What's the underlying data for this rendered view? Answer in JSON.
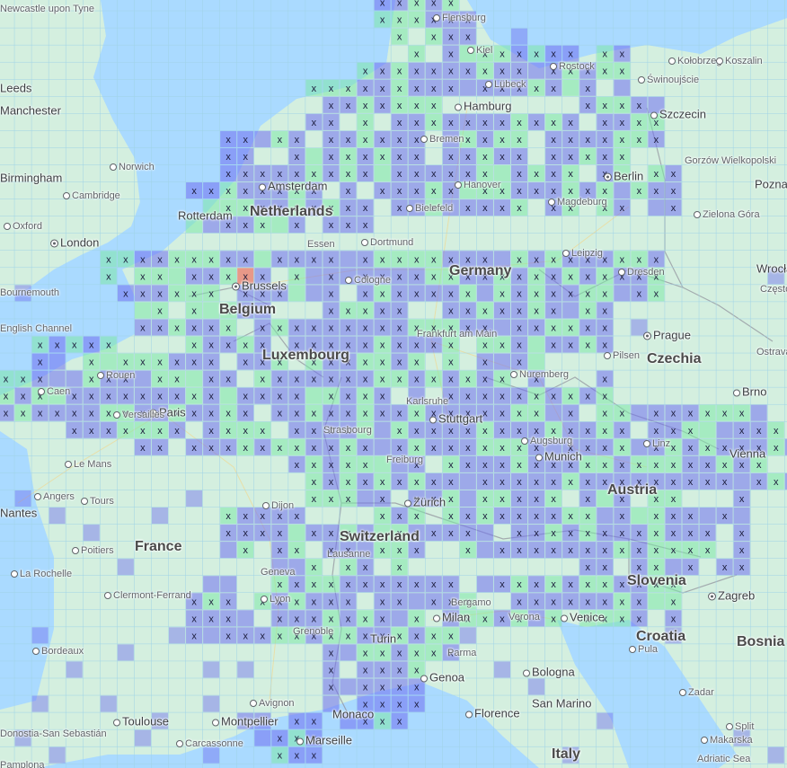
{
  "map": {
    "colors": {
      "sea": "#aadaff",
      "land": "#d4efdf",
      "cell_low": "#6f6ff0",
      "cell_mid": "#7de8a8",
      "cell_high": "#ef7b6b",
      "grid_line": "#9fd3e6",
      "mark": "#1a1a3a"
    },
    "cell_marker": "x",
    "labels": [
      {
        "id": "newcastle",
        "text": "Newcastle upon Tyne",
        "kind": "small"
      },
      {
        "id": "leeds",
        "text": "Leeds",
        "kind": "big"
      },
      {
        "id": "manchester",
        "text": "Manchester",
        "kind": "big"
      },
      {
        "id": "birmingham",
        "text": "Birmingham",
        "kind": "big"
      },
      {
        "id": "norwich",
        "text": "Norwich",
        "kind": "small",
        "dot": true
      },
      {
        "id": "cambridge",
        "text": "Cambridge",
        "kind": "small",
        "dot": true
      },
      {
        "id": "oxford",
        "text": "Oxford",
        "kind": "small",
        "dot": true
      },
      {
        "id": "london",
        "text": "London",
        "kind": "big",
        "dot": true,
        "capital": true
      },
      {
        "id": "bournemouth",
        "text": "Bournemouth",
        "kind": "small"
      },
      {
        "id": "flensburg",
        "text": "Flensburg",
        "kind": "small",
        "dot": true
      },
      {
        "id": "kiel",
        "text": "Kiel",
        "kind": "small",
        "dot": true
      },
      {
        "id": "rostock",
        "text": "Rostock",
        "kind": "small",
        "dot": true
      },
      {
        "id": "lubeck",
        "text": "Lübeck",
        "kind": "small",
        "dot": true
      },
      {
        "id": "kolobrzeg",
        "text": "Kołobrzeg",
        "kind": "small",
        "dot": true
      },
      {
        "id": "koszalin",
        "text": "Koszalin",
        "kind": "small",
        "dot": true
      },
      {
        "id": "swinoujscie",
        "text": "Świnoujście",
        "kind": "small",
        "dot": true
      },
      {
        "id": "hamburg",
        "text": "Hamburg",
        "kind": "big",
        "dot": true
      },
      {
        "id": "szczecin",
        "text": "Szczecin",
        "kind": "big",
        "dot": true
      },
      {
        "id": "bremen",
        "text": "Bremen",
        "kind": "small",
        "dot": true
      },
      {
        "id": "gorzow",
        "text": "Gorzów Wielkopolski",
        "kind": "small"
      },
      {
        "id": "poznan",
        "text": "Poznań",
        "kind": "big"
      },
      {
        "id": "berlin",
        "text": "Berlin",
        "kind": "big",
        "dot": true,
        "capital": true
      },
      {
        "id": "amsterdam",
        "text": "Amsterdam",
        "kind": "big",
        "dot": true
      },
      {
        "id": "hanover",
        "text": "Hanover",
        "kind": "small",
        "dot": true
      },
      {
        "id": "magdeburg",
        "text": "Magdeburg",
        "kind": "small",
        "dot": true
      },
      {
        "id": "netherlands",
        "text": "Netherlands",
        "kind": "country"
      },
      {
        "id": "rotterdam",
        "text": "Rotterdam",
        "kind": "big"
      },
      {
        "id": "bielefeld",
        "text": "Bielefeld",
        "kind": "small",
        "dot": true
      },
      {
        "id": "zielona",
        "text": "Zielona Góra",
        "kind": "small",
        "dot": true
      },
      {
        "id": "essen",
        "text": "Essen",
        "kind": "small"
      },
      {
        "id": "dortmund",
        "text": "Dortmund",
        "kind": "small",
        "dot": true
      },
      {
        "id": "leipzig",
        "text": "Leipzig",
        "kind": "small",
        "dot": true
      },
      {
        "id": "germany",
        "text": "Germany",
        "kind": "country"
      },
      {
        "id": "dresden",
        "text": "Dresden",
        "kind": "small",
        "dot": true
      },
      {
        "id": "wroclaw",
        "text": "Wrocław",
        "kind": "big"
      },
      {
        "id": "czestochowa",
        "text": "Częstochowa",
        "kind": "small"
      },
      {
        "id": "brussels",
        "text": "Brussels",
        "kind": "big",
        "dot": true,
        "capital": true
      },
      {
        "id": "cologne",
        "text": "Cologne",
        "kind": "small",
        "dot": true
      },
      {
        "id": "belgium",
        "text": "Belgium",
        "kind": "country"
      },
      {
        "id": "frankfurt",
        "text": "Frankfurt am Main",
        "kind": "small"
      },
      {
        "id": "prague",
        "text": "Prague",
        "kind": "big",
        "dot": true,
        "capital": true
      },
      {
        "id": "luxembourg",
        "text": "Luxembourg",
        "kind": "country"
      },
      {
        "id": "pilsen",
        "text": "Pilsen",
        "kind": "small",
        "dot": true
      },
      {
        "id": "czechia",
        "text": "Czechia",
        "kind": "country"
      },
      {
        "id": "ostrava",
        "text": "Ostrava",
        "kind": "small"
      },
      {
        "id": "rouen",
        "text": "Rouen",
        "kind": "small",
        "dot": true
      },
      {
        "id": "nuremberg",
        "text": "Nuremberg",
        "kind": "small",
        "dot": true
      },
      {
        "id": "caen",
        "text": "Caen",
        "kind": "small",
        "dot": true
      },
      {
        "id": "brno",
        "text": "Brno",
        "kind": "big",
        "dot": true
      },
      {
        "id": "paris",
        "text": "Paris",
        "kind": "big",
        "dot": true,
        "capital": true
      },
      {
        "id": "versailles",
        "text": "Versailles",
        "kind": "small",
        "dot": true
      },
      {
        "id": "karlsruhe",
        "text": "Karlsruhe",
        "kind": "small"
      },
      {
        "id": "stuttgart",
        "text": "Stuttgart",
        "kind": "big",
        "dot": true
      },
      {
        "id": "lemans",
        "text": "Le Mans",
        "kind": "small",
        "dot": true
      },
      {
        "id": "strasbourg",
        "text": "Strasbourg",
        "kind": "small"
      },
      {
        "id": "augsburg",
        "text": "Augsburg",
        "kind": "small",
        "dot": true
      },
      {
        "id": "linz",
        "text": "Linz",
        "kind": "small",
        "dot": true
      },
      {
        "id": "vienna",
        "text": "Vienna",
        "kind": "big"
      },
      {
        "id": "freiburg",
        "text": "Freiburg",
        "kind": "small"
      },
      {
        "id": "munich",
        "text": "Munich",
        "kind": "big",
        "dot": true
      },
      {
        "id": "angers",
        "text": "Angers",
        "kind": "small",
        "dot": true
      },
      {
        "id": "tours",
        "text": "Tours",
        "kind": "small",
        "dot": true
      },
      {
        "id": "nantes",
        "text": "Nantes",
        "kind": "big"
      },
      {
        "id": "zurich",
        "text": "Zürich",
        "kind": "big",
        "dot": true
      },
      {
        "id": "austria",
        "text": "Austria",
        "kind": "country"
      },
      {
        "id": "dijon",
        "text": "Dijon",
        "kind": "small",
        "dot": true
      },
      {
        "id": "france",
        "text": "France",
        "kind": "country"
      },
      {
        "id": "switzerland",
        "text": "Switzerland",
        "kind": "country"
      },
      {
        "id": "poitiers",
        "text": "Poitiers",
        "kind": "small",
        "dot": true
      },
      {
        "id": "lausanne",
        "text": "Lausanne",
        "kind": "small"
      },
      {
        "id": "geneva",
        "text": "Geneva",
        "kind": "small"
      },
      {
        "id": "larochelle",
        "text": "La Rochelle",
        "kind": "small",
        "dot": true
      },
      {
        "id": "slovenia",
        "text": "Slovenia",
        "kind": "country"
      },
      {
        "id": "clermont",
        "text": "Clermont-Ferrand",
        "kind": "small",
        "dot": true
      },
      {
        "id": "lyon",
        "text": "Lyon",
        "kind": "small",
        "dot": true
      },
      {
        "id": "zagreb",
        "text": "Zagreb",
        "kind": "big",
        "dot": true,
        "capital": true
      },
      {
        "id": "bergamo",
        "text": "Bergamo",
        "kind": "small"
      },
      {
        "id": "verona",
        "text": "Verona",
        "kind": "small"
      },
      {
        "id": "milan",
        "text": "Milan",
        "kind": "big",
        "dot": true
      },
      {
        "id": "venice",
        "text": "Venice",
        "kind": "big",
        "dot": true
      },
      {
        "id": "grenoble",
        "text": "Grenoble",
        "kind": "small"
      },
      {
        "id": "croatia",
        "text": "Croatia",
        "kind": "country"
      },
      {
        "id": "bordeaux",
        "text": "Bordeaux",
        "kind": "small",
        "dot": true
      },
      {
        "id": "turin",
        "text": "Turin",
        "kind": "big"
      },
      {
        "id": "parma",
        "text": "Parma",
        "kind": "small"
      },
      {
        "id": "pula",
        "text": "Pula",
        "kind": "small",
        "dot": true
      },
      {
        "id": "bosnia",
        "text": "Bosnia and Herzegovina",
        "kind": "country"
      },
      {
        "id": "genoa",
        "text": "Genoa",
        "kind": "big",
        "dot": true
      },
      {
        "id": "bologna",
        "text": "Bologna",
        "kind": "big",
        "dot": true
      },
      {
        "id": "zadar",
        "text": "Zadar",
        "kind": "small",
        "dot": true
      },
      {
        "id": "avignon",
        "text": "Avignon",
        "kind": "small",
        "dot": true
      },
      {
        "id": "sanmarino",
        "text": "San Marino",
        "kind": "big"
      },
      {
        "id": "toulouse",
        "text": "Toulouse",
        "kind": "big",
        "dot": true
      },
      {
        "id": "montpellier",
        "text": "Montpellier",
        "kind": "big",
        "dot": true
      },
      {
        "id": "monaco",
        "text": "Monaco",
        "kind": "big"
      },
      {
        "id": "florence",
        "text": "Florence",
        "kind": "big",
        "dot": true
      },
      {
        "id": "split",
        "text": "Split",
        "kind": "small",
        "dot": true
      },
      {
        "id": "donostia",
        "text": "Donostia-San Sebastián",
        "kind": "small"
      },
      {
        "id": "carcassonne",
        "text": "Carcassonne",
        "kind": "small",
        "dot": true
      },
      {
        "id": "marseille",
        "text": "Marseille",
        "kind": "big",
        "dot": true
      },
      {
        "id": "makarska",
        "text": "Makarska",
        "kind": "small",
        "dot": true
      },
      {
        "id": "italy",
        "text": "Italy",
        "kind": "country"
      },
      {
        "id": "pamplona",
        "text": "Pamplona",
        "kind": "small"
      },
      {
        "id": "adriatic",
        "text": "Adriatic Sea",
        "kind": "small"
      },
      {
        "id": "channel",
        "text": "English Channel",
        "kind": "small"
      }
    ]
  }
}
